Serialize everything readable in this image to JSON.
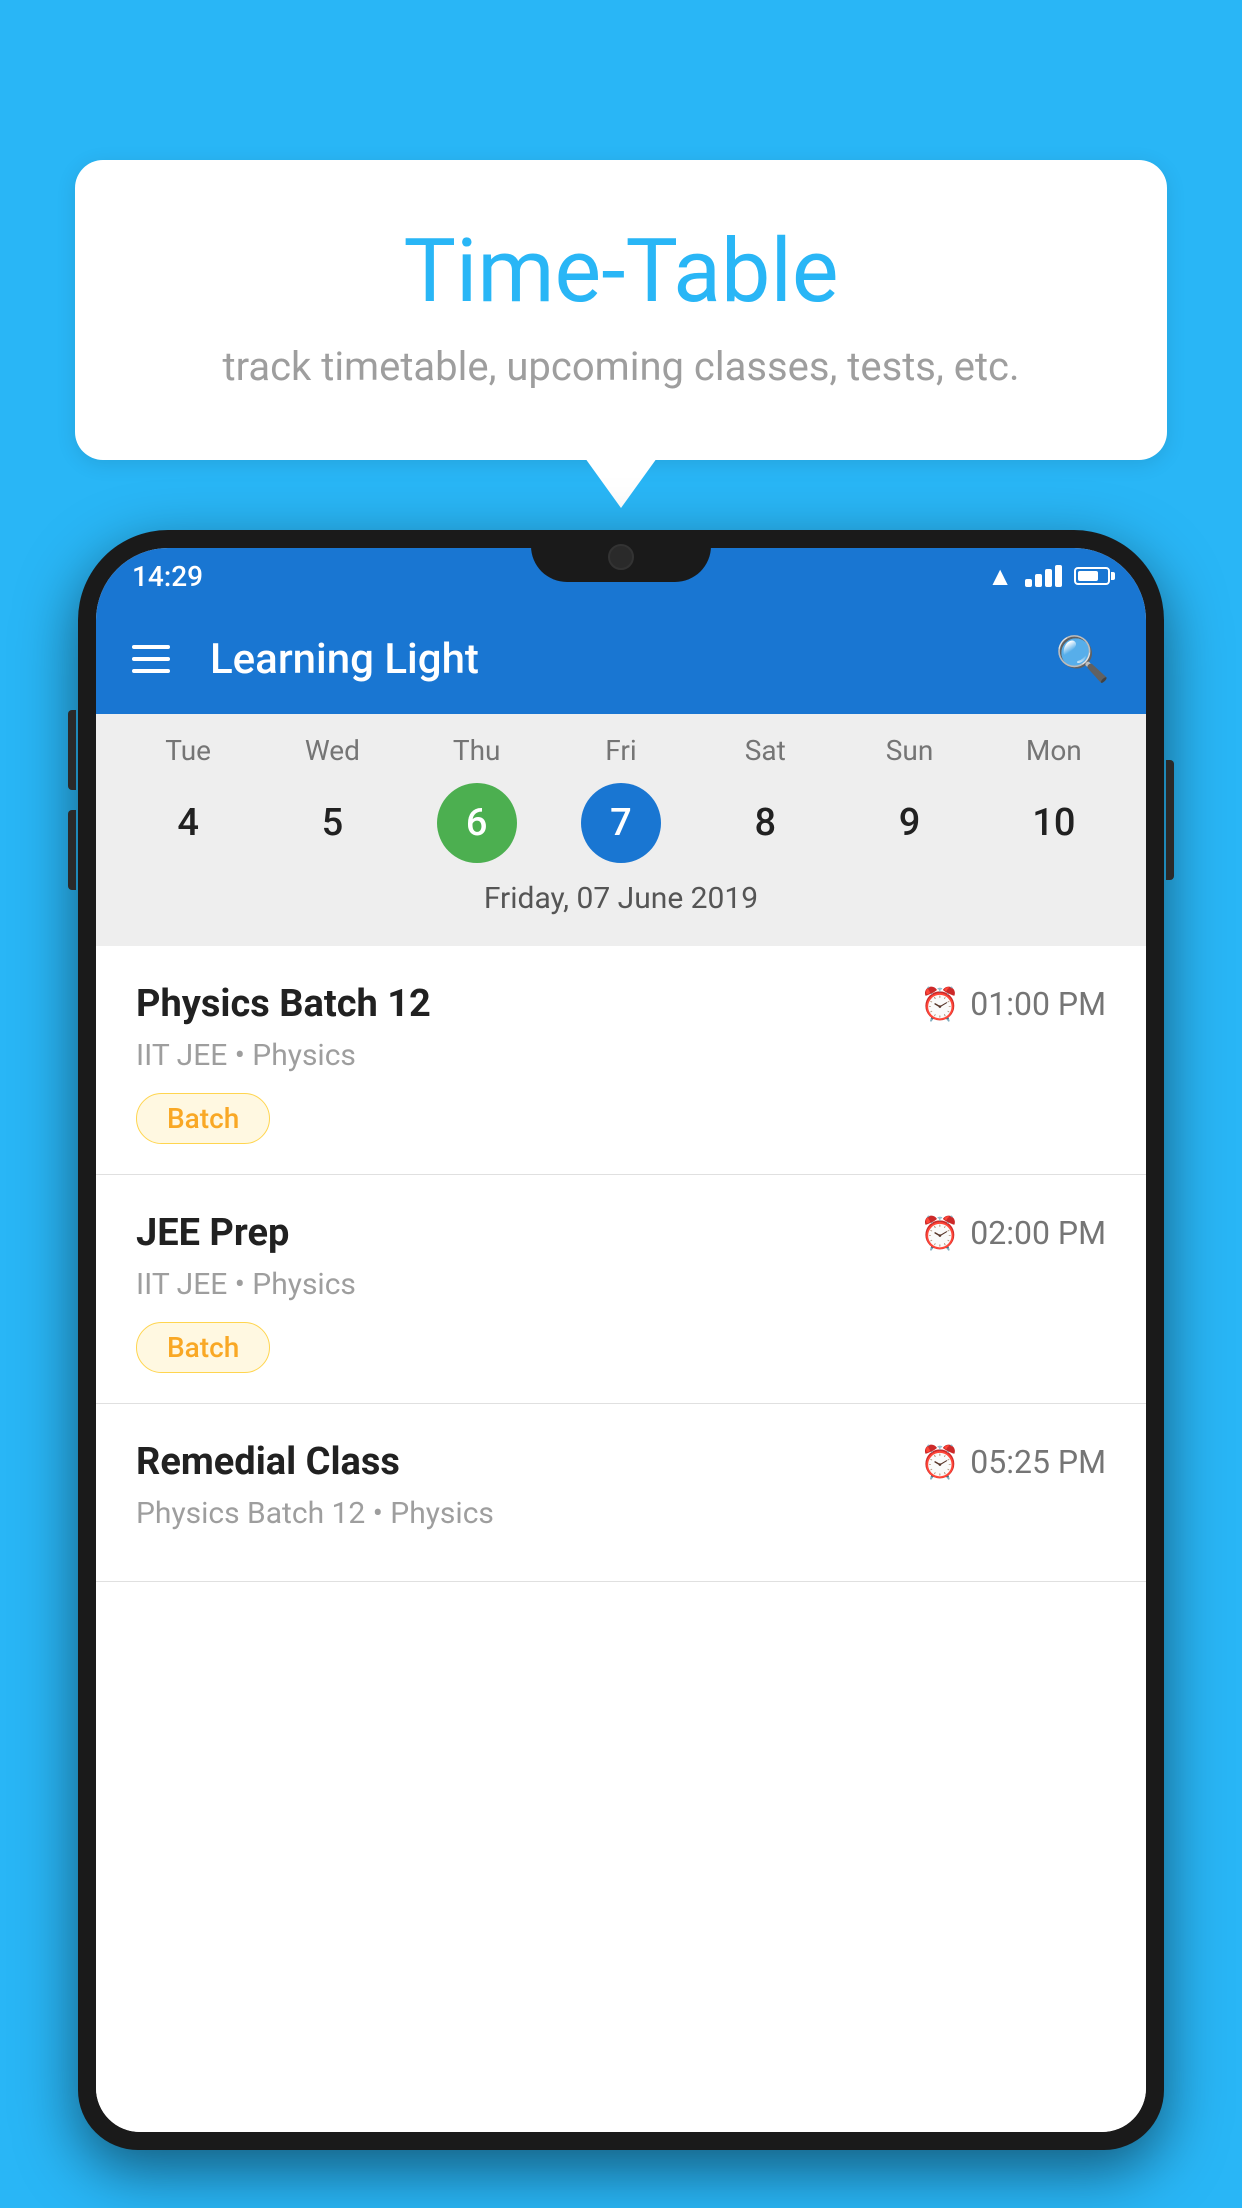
{
  "background_color": "#29B6F6",
  "bubble": {
    "title": "Time-Table",
    "subtitle": "track timetable, upcoming classes, tests, etc."
  },
  "phone": {
    "status_bar": {
      "time": "14:29"
    },
    "app_bar": {
      "title": "Learning Light"
    },
    "calendar": {
      "days": [
        "Tue",
        "Wed",
        "Thu",
        "Fri",
        "Sat",
        "Sun",
        "Mon"
      ],
      "dates": [
        "4",
        "5",
        "6",
        "7",
        "8",
        "9",
        "10"
      ],
      "today_index": 2,
      "selected_index": 3,
      "selected_label": "Friday, 07 June 2019"
    },
    "schedule": [
      {
        "title": "Physics Batch 12",
        "time": "01:00 PM",
        "subtitle": "IIT JEE • Physics",
        "badge": "Batch"
      },
      {
        "title": "JEE Prep",
        "time": "02:00 PM",
        "subtitle": "IIT JEE • Physics",
        "badge": "Batch"
      },
      {
        "title": "Remedial Class",
        "time": "05:25 PM",
        "subtitle": "Physics Batch 12 • Physics",
        "badge": ""
      }
    ]
  }
}
